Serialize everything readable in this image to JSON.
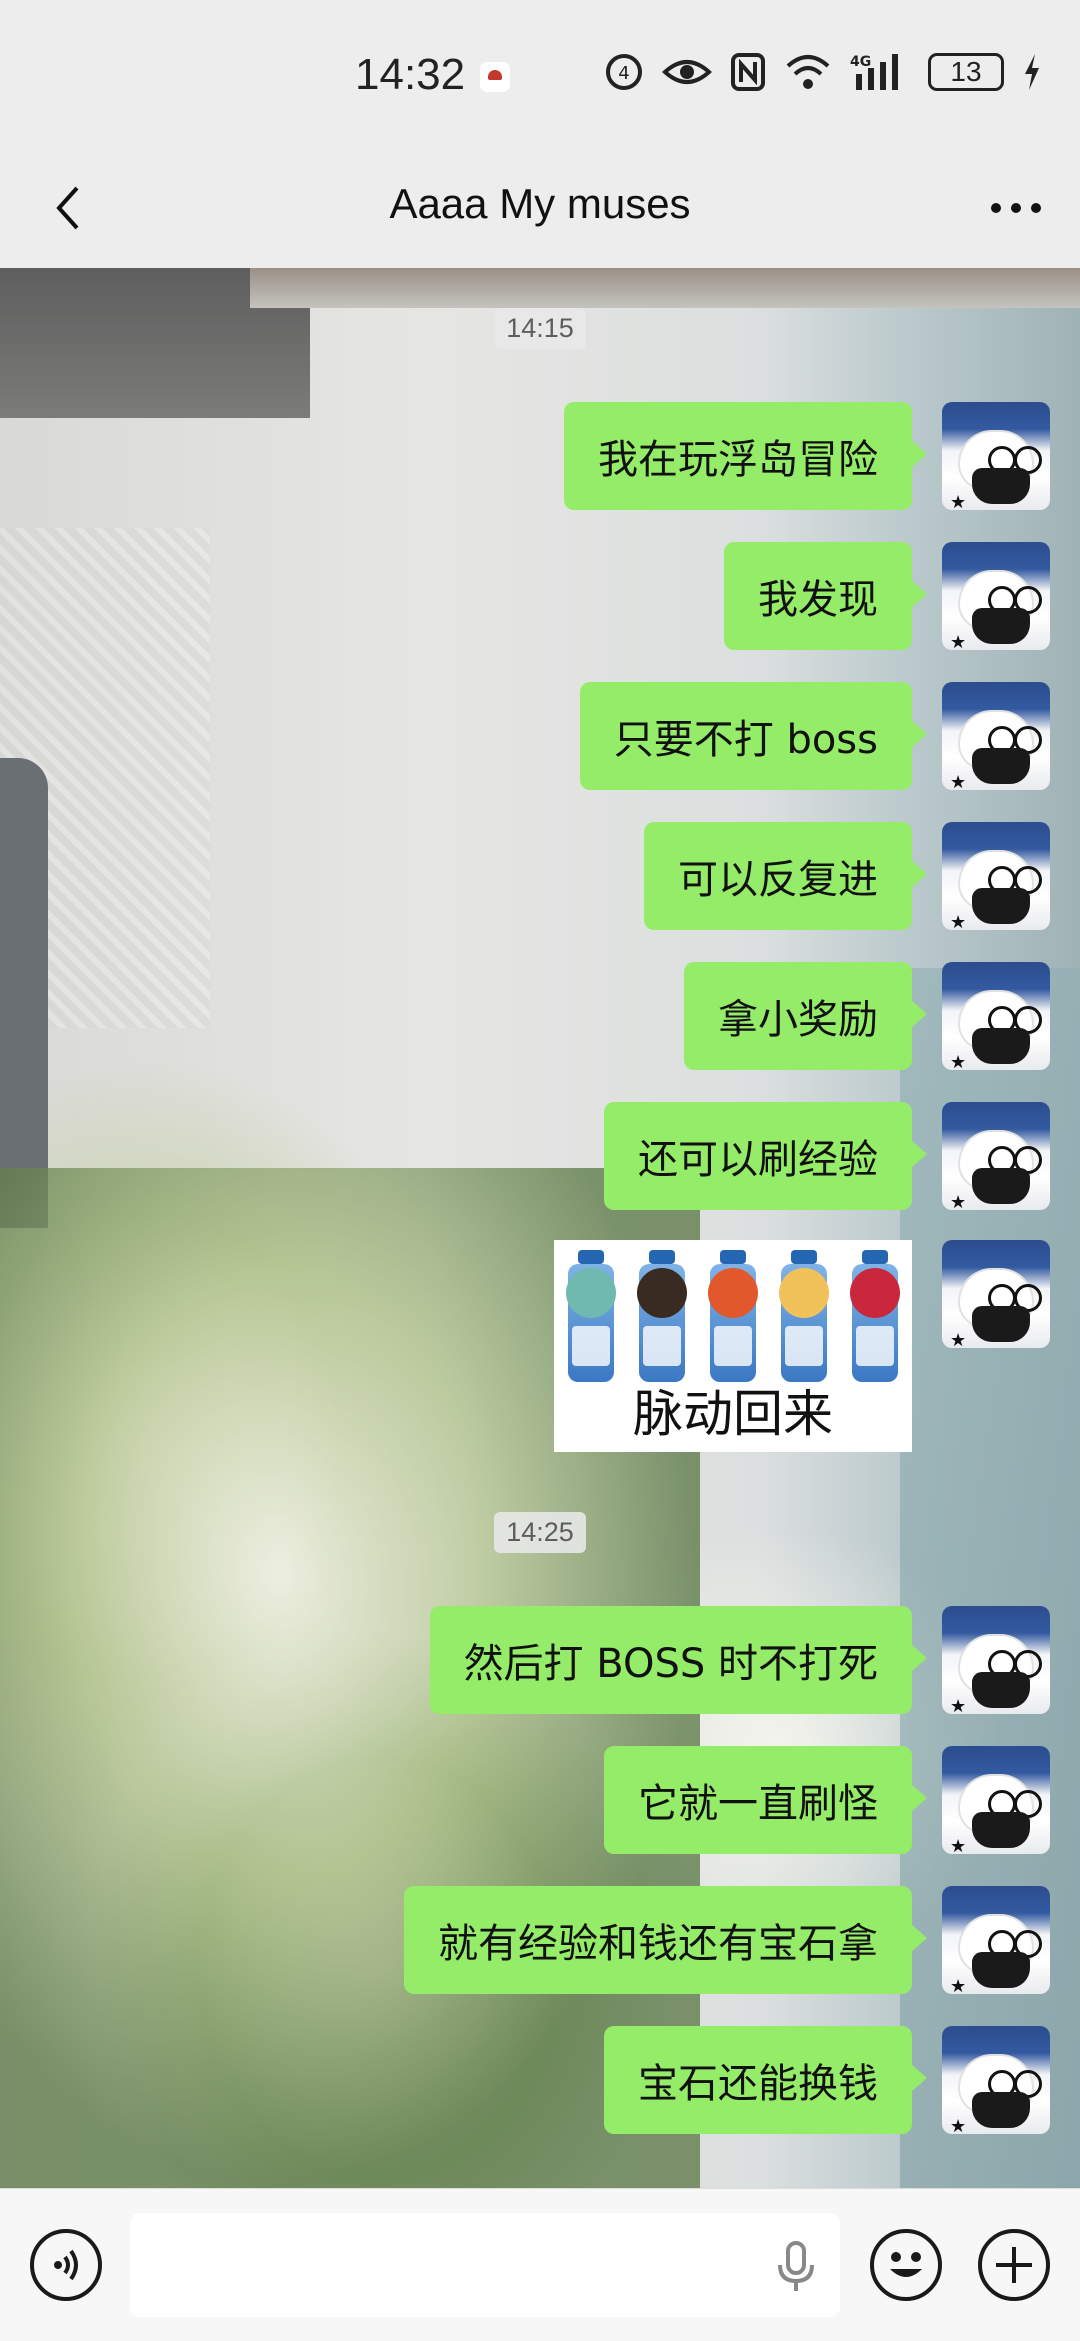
{
  "status_bar": {
    "time": "14:32",
    "battery": "13",
    "network": "4G"
  },
  "header": {
    "title": "Aaaa My muses"
  },
  "chat": {
    "separators": [
      "14:15",
      "14:25"
    ],
    "messages": [
      "我在玩浮岛冒险",
      "我发现",
      "只要不打 boss",
      "可以反复进",
      "拿小奖励",
      "还可以刷经验",
      "然后打 BOSS 时不打死",
      "它就一直刷怪",
      "就有经验和钱还有宝石拿",
      "宝石还能换钱"
    ],
    "sticker_caption": "脉动回来"
  },
  "icons": {
    "back": "chevron-left-icon",
    "more": "more-dots-icon",
    "voice": "voice-icon",
    "mic": "microphone-icon",
    "emoji": "emoji-icon",
    "plus": "plus-icon"
  },
  "colors": {
    "bubble": "#95ec69",
    "background": "#ededed"
  }
}
